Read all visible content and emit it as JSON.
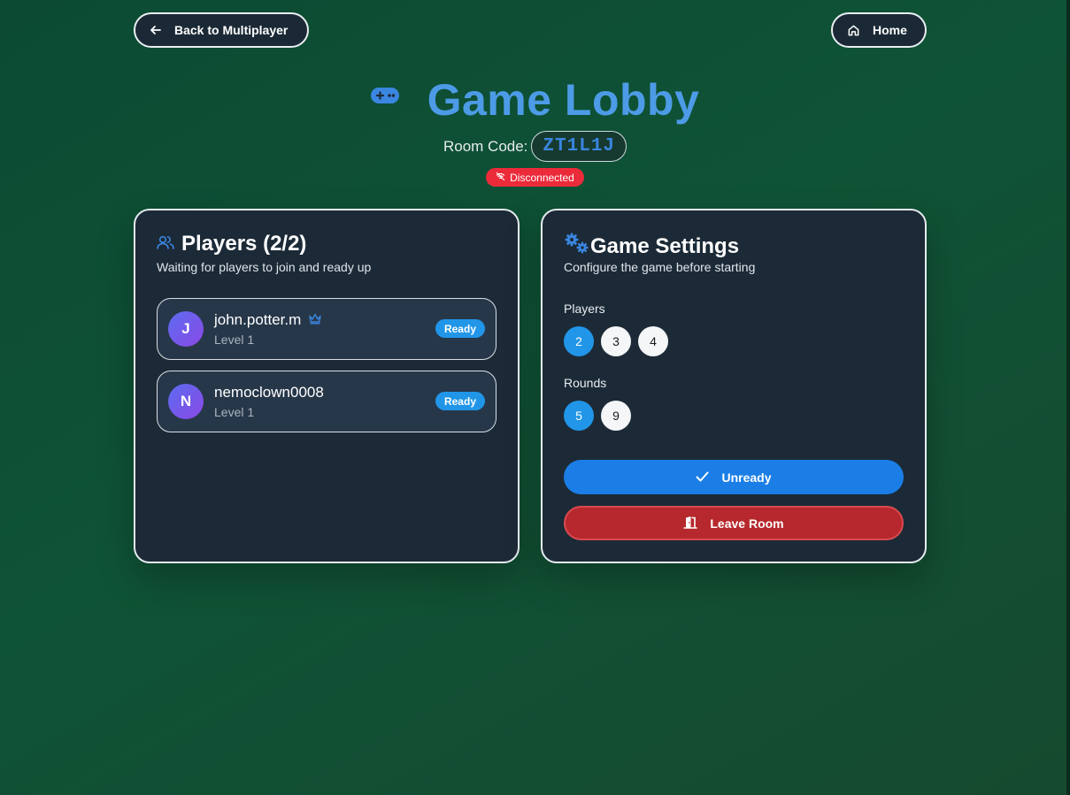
{
  "nav": {
    "back_label": "Back to Multiplayer",
    "home_label": "Home"
  },
  "header": {
    "title": "Game Lobby",
    "room_code_label": "Room Code:",
    "room_code": "ZT1L1J",
    "status": "Disconnected"
  },
  "players_card": {
    "title": "Players (2/2)",
    "subtitle": "Waiting for players to join and ready up",
    "players": [
      {
        "initial": "J",
        "name": "john.potter.m",
        "level": "Level 1",
        "status": "Ready",
        "is_host": true
      },
      {
        "initial": "N",
        "name": "nemoclown0008",
        "level": "Level 1",
        "status": "Ready",
        "is_host": false
      }
    ]
  },
  "settings_card": {
    "title": "Game Settings",
    "subtitle": "Configure the game before starting",
    "players_label": "Players",
    "players_options": [
      "2",
      "3",
      "4"
    ],
    "players_selected": "2",
    "rounds_label": "Rounds",
    "rounds_options": [
      "5",
      "9"
    ],
    "rounds_selected": "5",
    "unready_label": "Unready",
    "leave_label": "Leave Room"
  },
  "colors": {
    "accent": "#2196e8",
    "title": "#4d9be6",
    "danger": "#b6282d",
    "status_bad": "#ec2b3a"
  }
}
